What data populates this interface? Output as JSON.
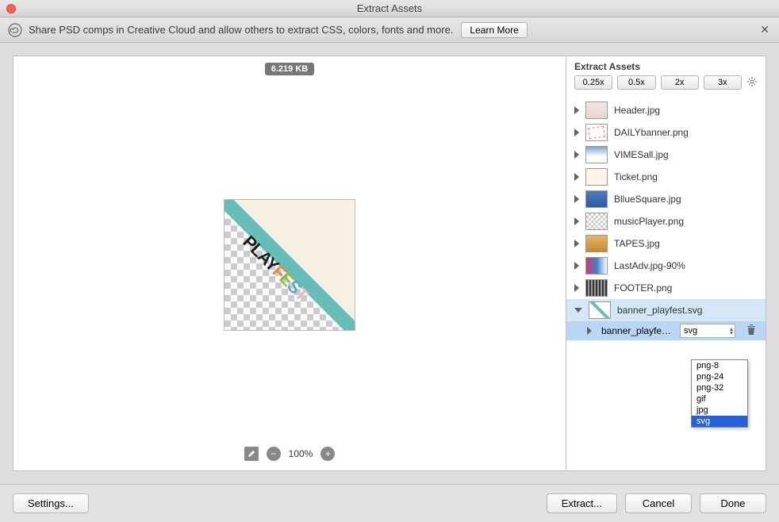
{
  "title": "Extract Assets",
  "infobar": {
    "text": "Share PSD comps in Creative Cloud and allow others to extract CSS, colors, fonts and more.",
    "learn_more": "Learn More"
  },
  "preview": {
    "filesize": "6.219 KB",
    "zoom": "100%"
  },
  "side": {
    "header": "Extract Assets",
    "scales": [
      "0.25x",
      "0.5x",
      "2x",
      "3x"
    ]
  },
  "assets": [
    {
      "name": "Header.jpg",
      "thumb": "th-header"
    },
    {
      "name": "DAILYbanner.png",
      "thumb": "th-daily"
    },
    {
      "name": "VIMESall.jpg",
      "thumb": "th-vimes"
    },
    {
      "name": "Ticket.png",
      "thumb": "th-ticket"
    },
    {
      "name": "BllueSquare.jpg",
      "thumb": "th-blue"
    },
    {
      "name": "musicPlayer.png",
      "thumb": "th-music"
    },
    {
      "name": "TAPES.jpg",
      "thumb": "th-tapes"
    },
    {
      "name": "LastAdv.jpg-90%",
      "thumb": "th-last"
    },
    {
      "name": "FOOTER.png",
      "thumb": "th-footer"
    },
    {
      "name": "banner_playfest.svg",
      "thumb": "th-banner",
      "expanded": true
    }
  ],
  "sub": {
    "name": "banner_playfest.sv",
    "format": "svg"
  },
  "formats": [
    "png-8",
    "png-24",
    "png-32",
    "gif",
    "jpg",
    "svg"
  ],
  "selected_format": "svg",
  "footer": {
    "settings": "Settings...",
    "extract": "Extract...",
    "cancel": "Cancel",
    "done": "Done"
  }
}
